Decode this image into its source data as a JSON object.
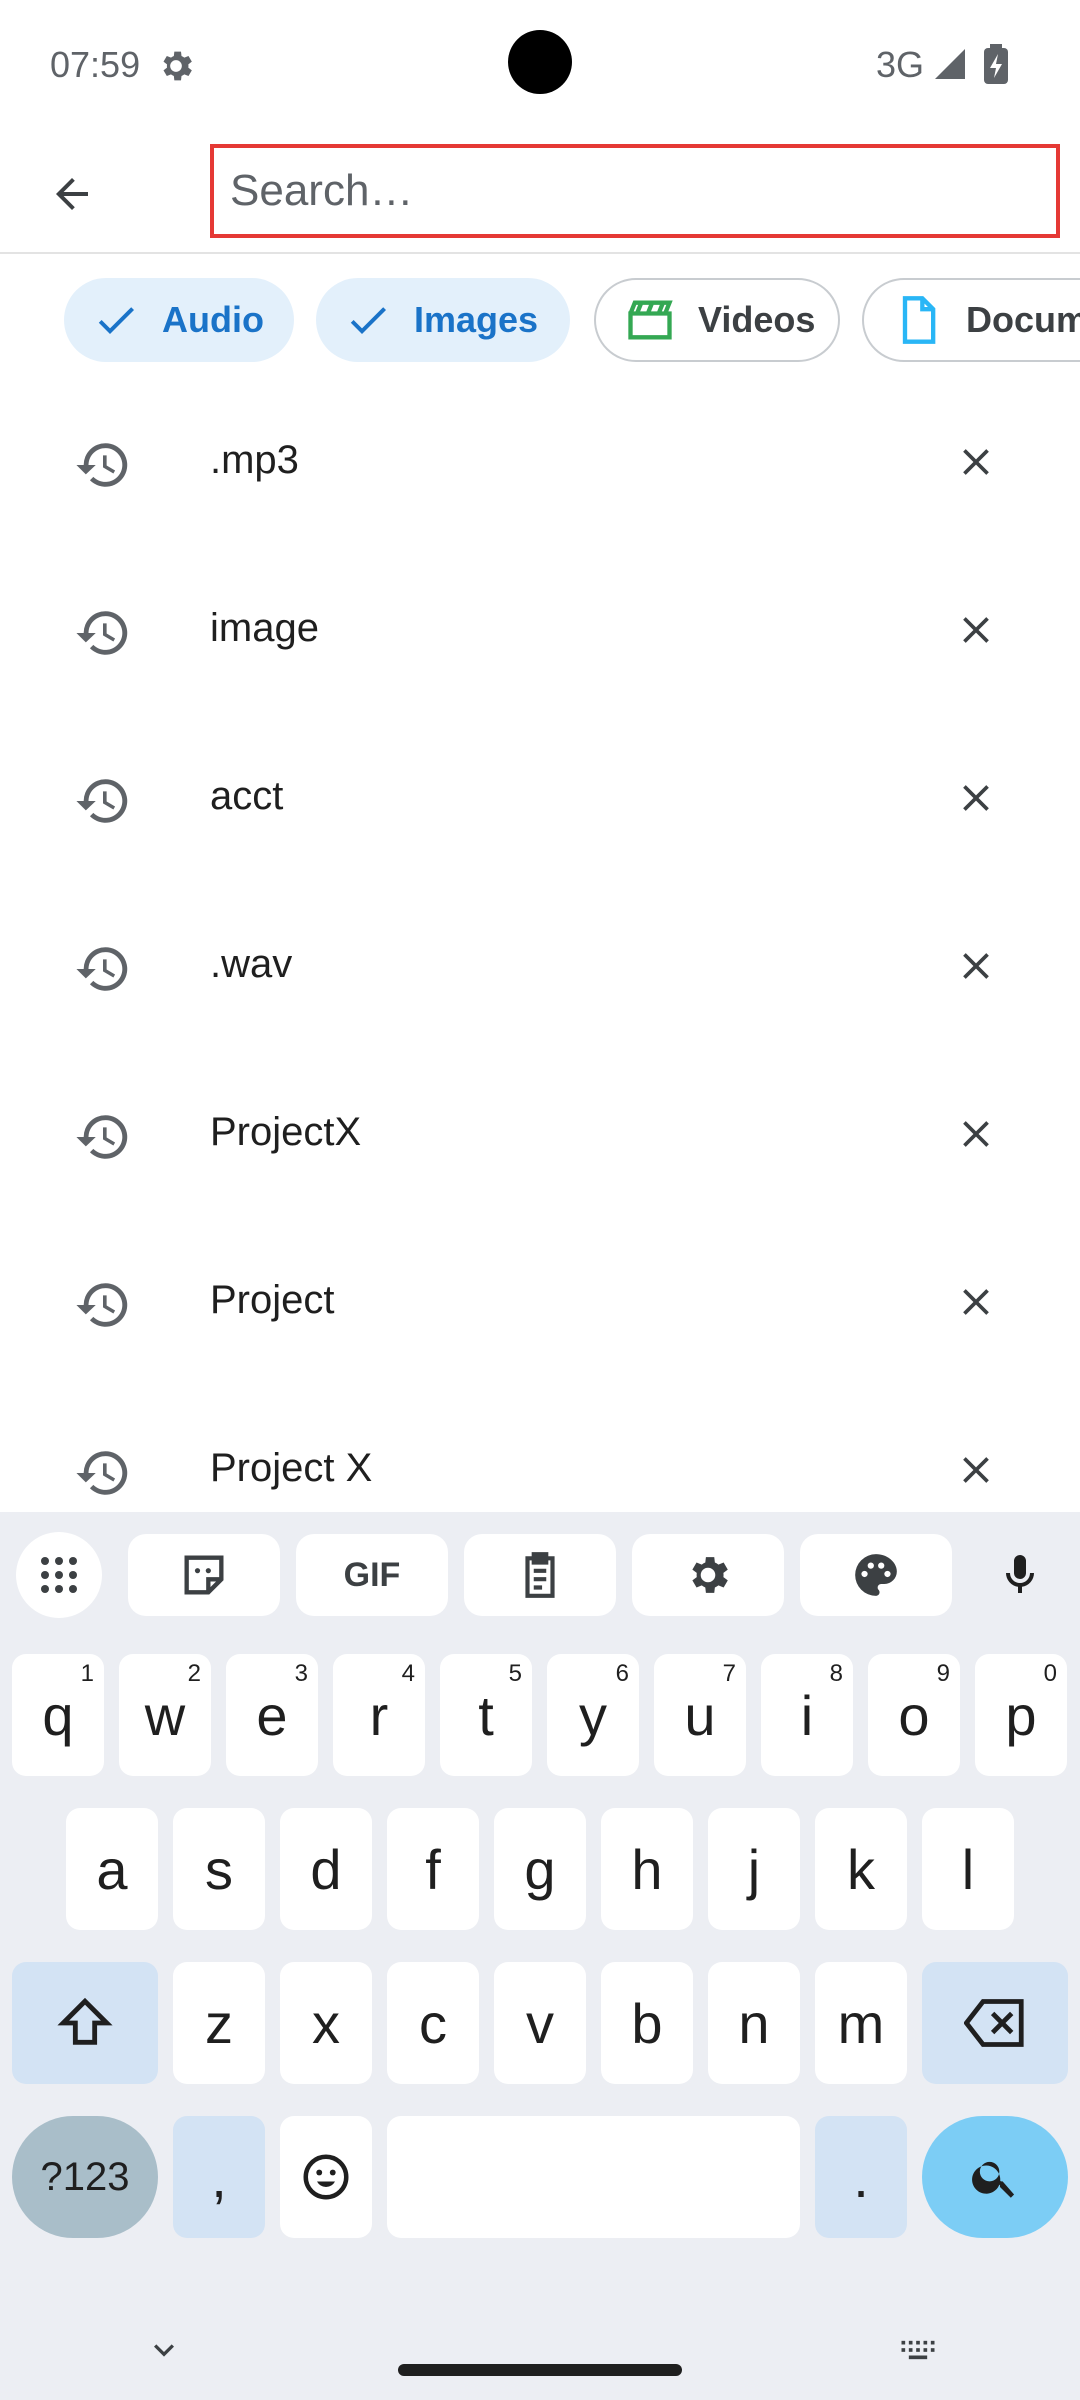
{
  "status_bar": {
    "time": "07:59",
    "network": "3G",
    "icons": [
      "gear-icon",
      "signal-icon",
      "battery-charging-icon"
    ]
  },
  "app_bar": {
    "back_icon": "arrow-back-icon",
    "search": {
      "value": "",
      "placeholder": "Search…",
      "highlight_color": "#e53935"
    }
  },
  "chips": [
    {
      "label": "Audio",
      "selected": true,
      "icon": "check-icon"
    },
    {
      "label": "Images",
      "selected": true,
      "icon": "check-icon"
    },
    {
      "label": "Videos",
      "selected": false,
      "icon": "clapperboard-icon"
    },
    {
      "label": "Docum",
      "selected": false,
      "icon": "document-icon"
    }
  ],
  "history": [
    {
      "label": ".mp3"
    },
    {
      "label": "image"
    },
    {
      "label": "acct"
    },
    {
      "label": ".wav"
    },
    {
      "label": "ProjectX"
    },
    {
      "label": "Project"
    },
    {
      "label": "Project X"
    }
  ],
  "keyboard": {
    "toolbar": [
      "apps-grid-icon",
      "sticker-icon",
      "GIF",
      "clipboard-icon",
      "gear-icon",
      "palette-icon",
      "microphone-icon"
    ],
    "row1": [
      {
        "key": "q",
        "hint": "1"
      },
      {
        "key": "w",
        "hint": "2"
      },
      {
        "key": "e",
        "hint": "3"
      },
      {
        "key": "r",
        "hint": "4"
      },
      {
        "key": "t",
        "hint": "5"
      },
      {
        "key": "y",
        "hint": "6"
      },
      {
        "key": "u",
        "hint": "7"
      },
      {
        "key": "i",
        "hint": "8"
      },
      {
        "key": "o",
        "hint": "9"
      },
      {
        "key": "p",
        "hint": "0"
      }
    ],
    "row2": [
      "a",
      "s",
      "d",
      "f",
      "g",
      "h",
      "j",
      "k",
      "l"
    ],
    "row3": [
      "z",
      "x",
      "c",
      "v",
      "b",
      "n",
      "m"
    ],
    "symbols_label": "?123",
    "comma": ",",
    "period": "."
  },
  "colors": {
    "accent": "#1a73c8",
    "chip_selected_bg": "#e3f0fb",
    "keyboard_bg": "#eceef3",
    "search_key": "#7ccdf5"
  }
}
